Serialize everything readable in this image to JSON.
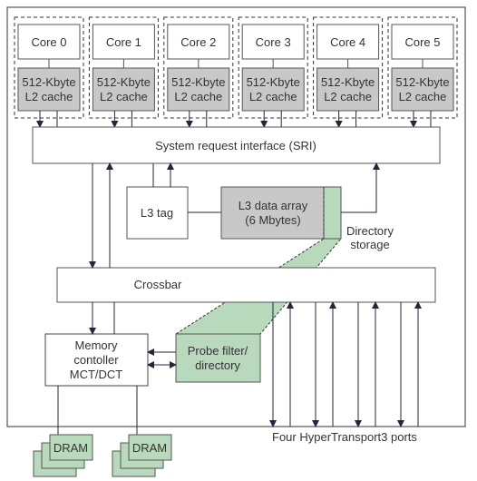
{
  "colors": {
    "green": "#b9d9bd",
    "gray": "#c8c8c8",
    "line": "#222638",
    "frame": "#555"
  },
  "cores": [
    {
      "core": "Core 0",
      "cache_line1": "512-Kbyte",
      "cache_line2": "L2 cache"
    },
    {
      "core": "Core 1",
      "cache_line1": "512-Kbyte",
      "cache_line2": "L2 cache"
    },
    {
      "core": "Core 2",
      "cache_line1": "512-Kbyte",
      "cache_line2": "L2 cache"
    },
    {
      "core": "Core 3",
      "cache_line1": "512-Kbyte",
      "cache_line2": "L2 cache"
    },
    {
      "core": "Core 4",
      "cache_line1": "512-Kbyte",
      "cache_line2": "L2 cache"
    },
    {
      "core": "Core 5",
      "cache_line1": "512-Kbyte",
      "cache_line2": "L2 cache"
    }
  ],
  "sri": "System request interface (SRI)",
  "l3_tag": "L3 tag",
  "l3_data": {
    "line1": "L3 data array",
    "line2": "(6 Mbytes)"
  },
  "directory_storage": {
    "line1": "Directory",
    "line2": "storage"
  },
  "crossbar": "Crossbar",
  "memory_controller": {
    "line1": "Memory",
    "line2": "contoller",
    "line3": "MCT/DCT"
  },
  "probe_filter": {
    "line1": "Probe filter/",
    "line2": "directory"
  },
  "dram": [
    "DRAM",
    "DRAM"
  ],
  "ht_ports": "Four HyperTransport3 ports"
}
